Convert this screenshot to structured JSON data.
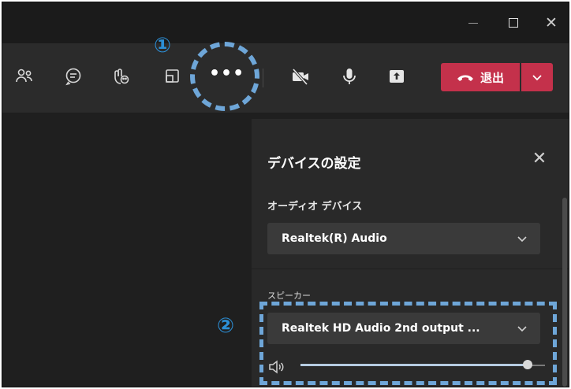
{
  "annotations": {
    "step1": "①",
    "step2": "②"
  },
  "window": {
    "minimize": "",
    "maximize": "",
    "close": "✕"
  },
  "toolbar": {
    "icons": [
      "people-icon",
      "chat-icon",
      "reactions-icon",
      "rooms-icon"
    ],
    "more_label": "•••",
    "camera_icon": "camera-off-icon",
    "mic_icon": "microphone-icon",
    "share_icon": "share-icon",
    "leave_label": "退出",
    "leave_icon": "phone-hangup-icon"
  },
  "panel": {
    "title": "デバイスの設定",
    "close": "✕",
    "audio_device_label": "オーディオ デバイス",
    "audio_device_value": "Realtek(R) Audio",
    "speaker_label": "スピーカー",
    "speaker_value": "Realtek HD Audio 2nd output ...",
    "volume_level": 0.93
  },
  "colors": {
    "leave": "#c4314b",
    "annotation": "#6ea6d8",
    "annotation_text": "#2c8fd6",
    "panel_bg": "#292929",
    "app_bg": "#1f1f1f"
  }
}
